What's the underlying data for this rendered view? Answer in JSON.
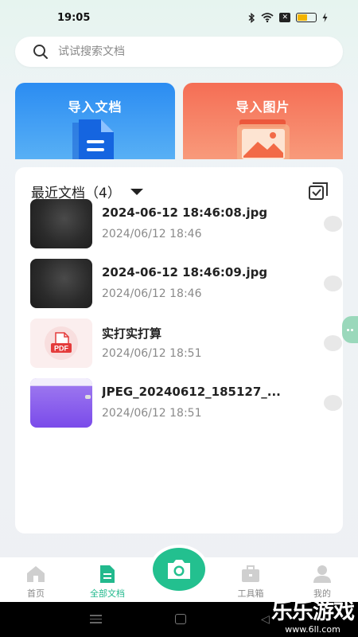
{
  "status": {
    "time": "19:05",
    "icons": [
      "bluetooth-icon",
      "wifi-icon",
      "x-icon",
      "battery-icon",
      "charging-icon"
    ],
    "x_badge": "✕",
    "battery_level": 0.55
  },
  "search": {
    "placeholder": "试试搜索文档",
    "value": ""
  },
  "import": {
    "doc_label": "导入文档",
    "image_label": "导入图片",
    "doc_color": "#2b8cf2",
    "image_color": "#f56e55"
  },
  "recent": {
    "title": "最近文档（4）",
    "items": [
      {
        "name": "2024-06-12 18:46:08.jpg",
        "date": "2024/06/12 18:46",
        "thumb": "photo-dark"
      },
      {
        "name": "2024-06-12 18:46:09.jpg",
        "date": "2024/06/12 18:46",
        "thumb": "photo-dark"
      },
      {
        "name": "实打实打算",
        "date": "2024/06/12 18:51",
        "thumb": "pdf-icon",
        "badge": "PDF"
      },
      {
        "name": "JPEG_20240612_185127_...",
        "date": "2024/06/12 18:51",
        "thumb": "photo-purple"
      }
    ]
  },
  "nav": {
    "items": [
      {
        "label": "首页",
        "icon": "home-icon",
        "active": false
      },
      {
        "label": "全部文档",
        "icon": "document-icon",
        "active": true
      },
      {
        "label": "工具箱",
        "icon": "toolbox-icon",
        "active": false
      },
      {
        "label": "我的",
        "icon": "person-icon",
        "active": false
      }
    ],
    "camera_icon": "camera-icon",
    "accent": "#23c08f"
  },
  "watermark": {
    "main": "乐乐游戏",
    "sub": "www.6ll.com"
  }
}
